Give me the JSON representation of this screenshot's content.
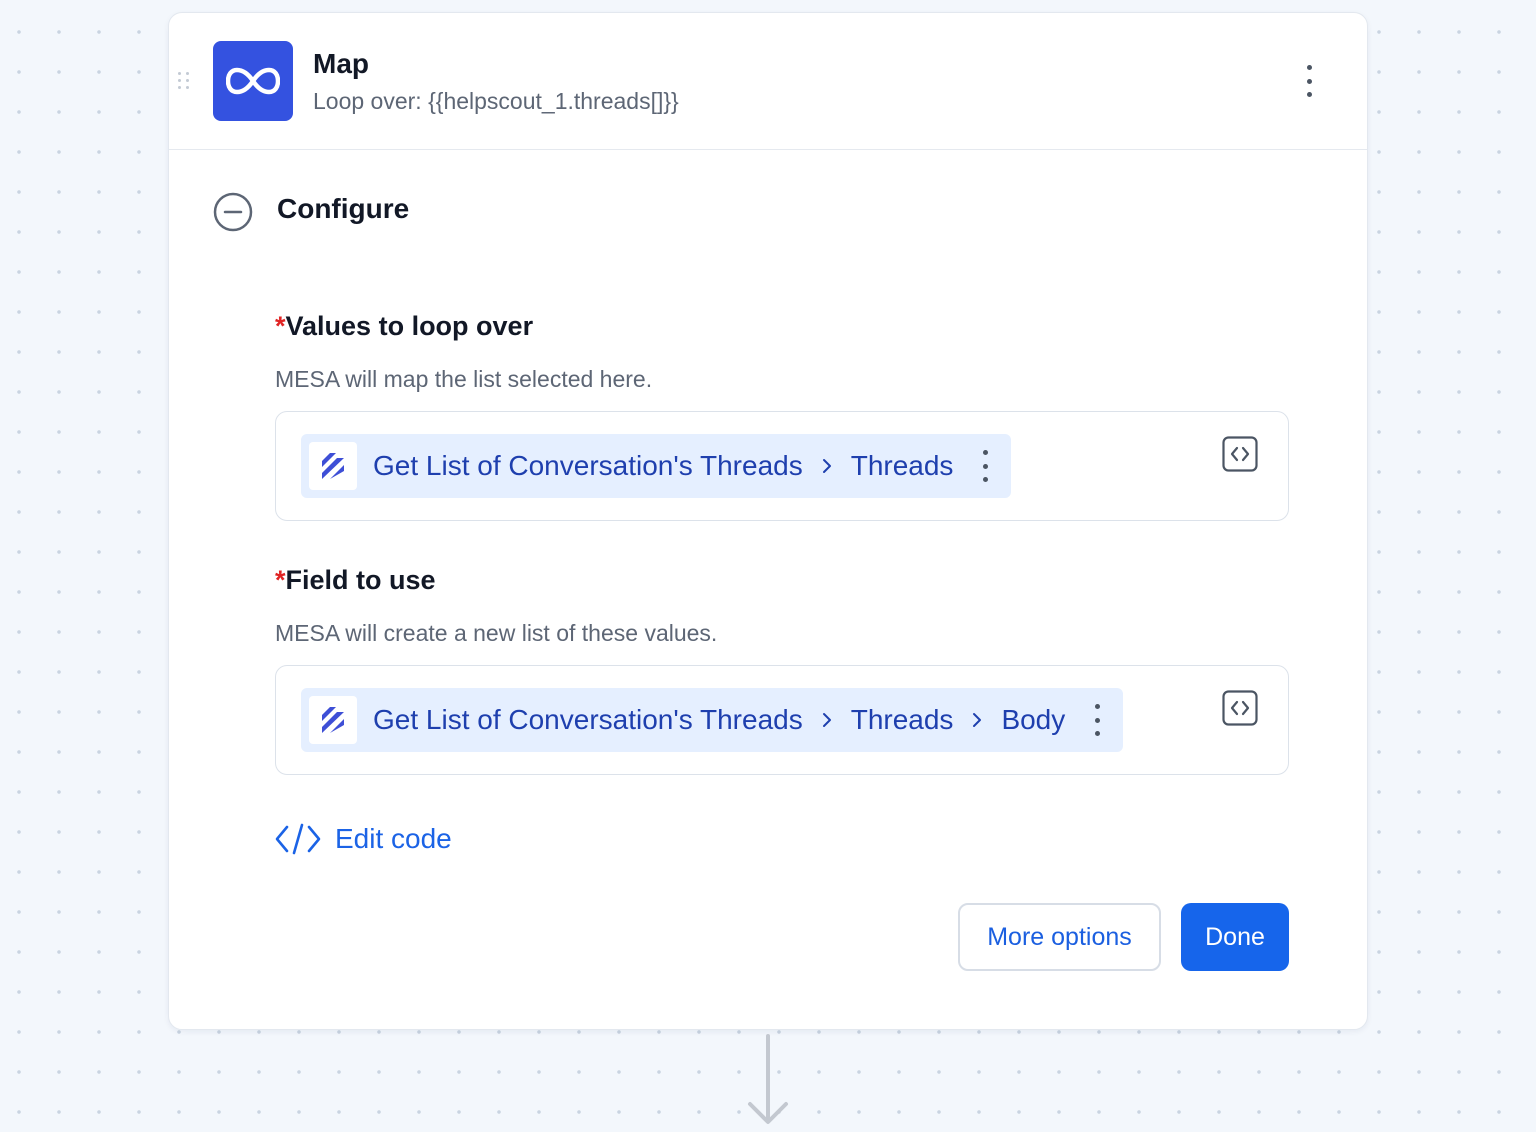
{
  "step": {
    "title": "Map",
    "subtitle": "Loop over: {{helpscout_1.threads[]}}",
    "icon": "infinity-icon",
    "icon_color": "#3452e0"
  },
  "section": {
    "title": "Configure",
    "collapse_icon": "minus-circle-icon"
  },
  "fields": [
    {
      "required_mark": "*",
      "label": "Values to loop over",
      "help": "MESA will map the list selected here.",
      "token": {
        "app_icon": "helpscout-logo-icon",
        "path": [
          "Get List of Conversation's Threads",
          "Threads"
        ]
      }
    },
    {
      "required_mark": "*",
      "label": "Field to use",
      "help": "MESA will create a new list of these values.",
      "token": {
        "app_icon": "helpscout-logo-icon",
        "path": [
          "Get List of Conversation's Threads",
          "Threads",
          "Body"
        ]
      }
    }
  ],
  "edit_code": {
    "label": "Edit code",
    "icon": "code-icon"
  },
  "buttons": {
    "more_options": "More options",
    "done": "Done"
  },
  "colors": {
    "accent": "#1665eb",
    "token_bg": "#e5efff",
    "token_text": "#1e3fae",
    "required": "#e02424"
  }
}
